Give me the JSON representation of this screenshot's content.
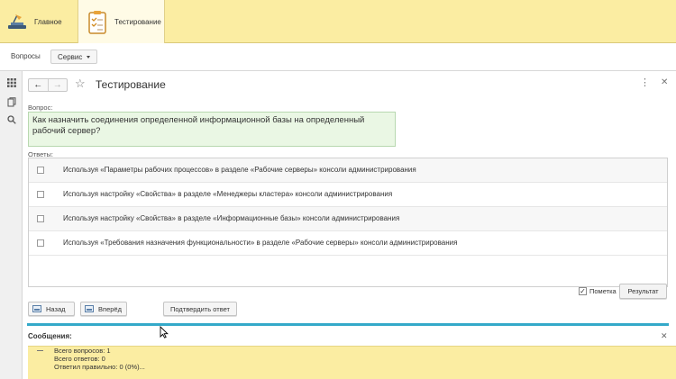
{
  "sections": {
    "home_label": "Главное",
    "testing_label": "Тестирование"
  },
  "commands": {
    "questions_label": "Вопросы",
    "service_label": "Сервис"
  },
  "form": {
    "title": "Тестирование",
    "question_label": "Вопрос:",
    "question_text": "Как назначить соединения определенной информационной базы на определенный рабочий сервер?",
    "answers_label": "Ответы:",
    "answers": [
      "Используя «Параметры рабочих процессов» в разделе «Рабочие серверы» консоли администрирования",
      "Используя настройку «Свойства» в разделе «Менеджеры кластера» консоли администрирования",
      "Используя настройку «Свойства» в разделе «Информационные базы» консоли администрирования",
      "Используя «Требования назначения функциональности» в разделе «Рабочие серверы» консоли администрирования"
    ],
    "mark_label": "Пометка",
    "mark_checked": "✓",
    "result_label": "Результат",
    "back_label": "Назад",
    "forward_label": "Вперёд",
    "confirm_label": "Подтвердить ответ"
  },
  "messages": {
    "title": "Сообщения:",
    "lines": [
      "Всего вопросов: 1",
      "Всего ответов: 0",
      "Ответил правильно: 0 (0%)..."
    ]
  },
  "colors": {
    "section_bar": "#fbeda2",
    "question_bg": "#eaf7e4",
    "separator": "#34a9c9"
  }
}
